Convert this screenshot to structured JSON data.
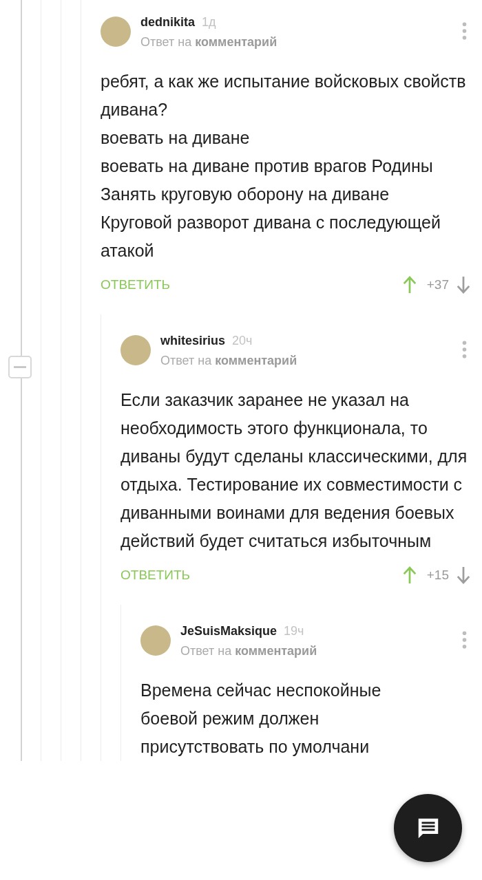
{
  "collapse_button": {
    "expanded": true
  },
  "comments": [
    {
      "author": "dednikita",
      "time": "1д",
      "reply_info": "Ответ на **комментарий**",
      "body": [
        "ребят, а как же испытание войсковых свойств дивана?",
        "воевать на диване",
        "воевать на диване против врагов Родины",
        "Занять круговую оборону на диване",
        "Круговой разворот дивана с последующей атакой"
      ],
      "reply_label": "ОТВЕТИТЬ",
      "score": "+37",
      "upvoted": true,
      "children": [
        {
          "author": "whitesirius",
          "time": "20ч",
          "reply_info": "Ответ на **комментарий**",
          "body": [
            "Если заказчик заранее не указал на необходимость этого функционала, то диваны будут сделаны классическими, для отдыха. Тестирование их совместимости с диванными воинами для ведения боевых действий будет считаться избыточным"
          ],
          "reply_label": "ОТВЕТИТЬ",
          "score": "+15",
          "upvoted": true,
          "children": [
            {
              "author": "JeSuisMaksique",
              "time": "19ч",
              "reply_info": "Ответ на **комментарий**",
              "body": [
                "Времена сейчас неспокойные",
                "боевой режим должен",
                "присутствовать по умолчани"
              ]
            }
          ]
        }
      ]
    }
  ]
}
